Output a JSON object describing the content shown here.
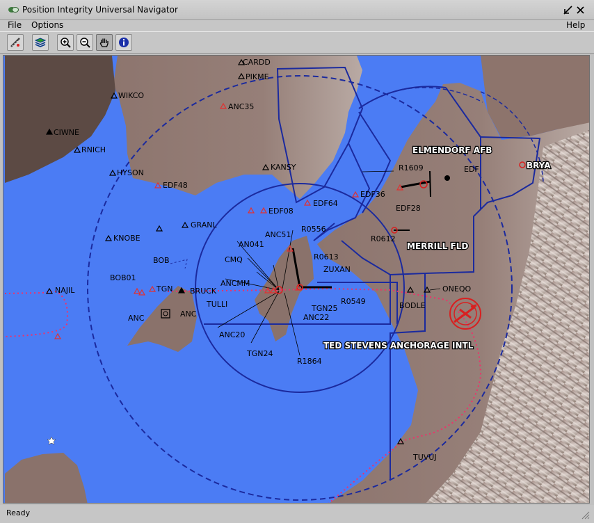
{
  "window": {
    "title": "Position Integrity Universal Navigator"
  },
  "menu": {
    "file": "File",
    "options": "Options",
    "help": "Help"
  },
  "toolbar": {
    "buttons": [
      "ruler-tool-icon",
      "layers-icon",
      "zoom-in-icon",
      "zoom-out-icon",
      "pan-hand-icon",
      "info-icon"
    ],
    "pressed": "pan-hand-icon"
  },
  "map": {
    "colors": {
      "water": "#4b7cf4",
      "land": "#8e7770",
      "airspace": "#1b2a9e",
      "waypoint_red": "#e23030",
      "route_red": "#f0306a"
    },
    "airport_labels": {
      "elmendorf": "ELMENDORF AFB",
      "merrill": "MERRILL FLD",
      "ted_stevens": "TED STEVENS ANCHORAGE INTL",
      "bryant": "BRYA"
    },
    "waypoints": {
      "cardd": "CARDD",
      "pikme": "PIKME",
      "wikco": "WIKCO",
      "anc35": "ANC35",
      "ciwne": "CIWNE",
      "rnich": "RNICH",
      "hyson": "HYSON",
      "kansy": "KANSY",
      "edf48": "EDF48",
      "edf08": "EDF08",
      "edf64": "EDF64",
      "edf36": "EDF36",
      "r1609": "R1609",
      "edf": "EDF",
      "edf28": "EDF28",
      "r0612": "R0612",
      "granl": "GRANL",
      "knobe": "KNOBE",
      "r0556": "R0556",
      "anc51": "ANC51",
      "an041": "AN041",
      "cmq": "CMQ",
      "r0613": "R0613",
      "zuxan": "ZUXAN",
      "bob": "BOB",
      "bob01": "BOB01",
      "najil": "NAJIL",
      "tgn": "TGN",
      "bruck": "BRUCK",
      "ancmm": "ANCMM",
      "tulli": "TULLI",
      "r0549": "R0549",
      "tgn25": "TGN25",
      "anc22": "ANC22",
      "anc_vor": "ANC",
      "anc_apt": "ANC",
      "anc20": "ANC20",
      "tgn24": "TGN24",
      "r1864": "R1864",
      "oneqo": "ONEQO",
      "bodle": "BODLE",
      "tuvuj": "TUVUJ"
    }
  },
  "status": {
    "text": "Ready"
  }
}
